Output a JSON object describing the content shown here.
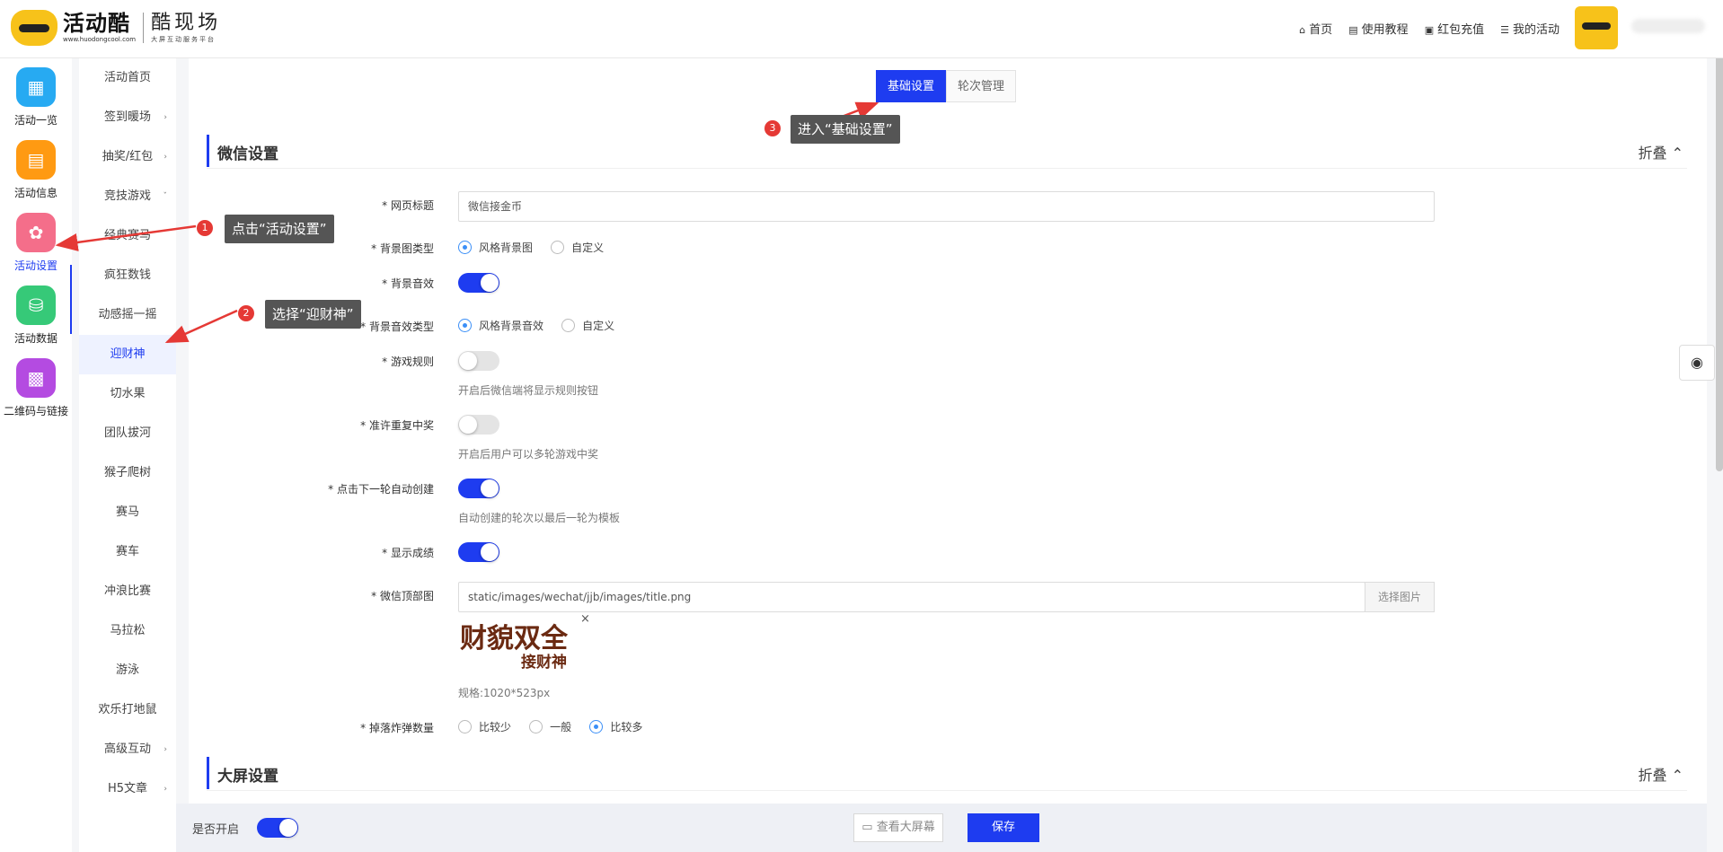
{
  "header": {
    "logo_main": "活动酷",
    "logo_url": "www.huodongcool.com",
    "logo_title": "酷现场",
    "logo_subtitle": "大屏互动服务平台",
    "nav": [
      {
        "icon": "home-icon",
        "label": "首页"
      },
      {
        "icon": "book-icon",
        "label": "使用教程"
      },
      {
        "icon": "wallet-icon",
        "label": "红包充值"
      },
      {
        "icon": "list-icon",
        "label": "我的活动"
      }
    ]
  },
  "rail": [
    {
      "label": "活动一览",
      "icon": "grid-icon",
      "color": "#27aaf2"
    },
    {
      "label": "活动信息",
      "icon": "document-icon",
      "color": "#ff9a12"
    },
    {
      "label": "活动设置",
      "icon": "gear-icon",
      "color": "#f46e8a",
      "active": true
    },
    {
      "label": "活动数据",
      "icon": "database-icon",
      "color": "#36c978"
    },
    {
      "label": "二维码与链接",
      "icon": "qrcode-icon",
      "color": "#b44be1"
    }
  ],
  "submenu": [
    {
      "label": "活动首页"
    },
    {
      "label": "签到暖场",
      "arrow": "›"
    },
    {
      "label": "抽奖/红包",
      "arrow": "›"
    },
    {
      "label": "竞技游戏",
      "arrow": "ˇ"
    },
    {
      "label": "经典赛马"
    },
    {
      "label": "疯狂数钱"
    },
    {
      "label": "动感摇一摇"
    },
    {
      "label": "迎财神",
      "active": true
    },
    {
      "label": "切水果"
    },
    {
      "label": "团队拔河"
    },
    {
      "label": "猴子爬树"
    },
    {
      "label": "赛马"
    },
    {
      "label": "赛车"
    },
    {
      "label": "冲浪比赛"
    },
    {
      "label": "马拉松"
    },
    {
      "label": "游泳"
    },
    {
      "label": "欢乐打地鼠"
    },
    {
      "label": "高级互动",
      "arrow": "›"
    },
    {
      "label": "H5文章",
      "arrow": "›"
    }
  ],
  "tabs": [
    "基础设置",
    "轮次管理"
  ],
  "wechat_section": {
    "title": "微信设置",
    "fold": "折叠 ⌃"
  },
  "screen_section": {
    "title": "大屏设置",
    "fold": "折叠 ⌃"
  },
  "form": {
    "page_title_label": "* 网页标题",
    "page_title_value": "微信接金币",
    "bg_type_label": "* 背景图类型",
    "bg_type_opt1": "风格背景图",
    "bg_type_opt2": "自定义",
    "bg_sound_label": "* 背景音效",
    "bg_sound_type_label": "* 背景音效类型",
    "bg_sound_opt1": "风格背景音效",
    "bg_sound_opt2": "自定义",
    "rules_label": "* 游戏规则",
    "rules_hint": "开启后微信端将显示规则按钮",
    "repeat_label": "* 准许重复中奖",
    "repeat_hint": "开启后用户可以多轮游戏中奖",
    "auto_label": "* 点击下一轮自动创建",
    "auto_hint": "自动创建的轮次以最后一轮为模板",
    "score_label": "* 显示成绩",
    "top_img_label": "* 微信顶部图",
    "top_img_value": "static/images/wechat/jjb/images/title.png",
    "pick_image": "选择图片",
    "image_text_1": "财貌双全",
    "image_text_2": "接财神",
    "close": "×",
    "spec": "规格:1020*523px",
    "bomb_label": "* 掉落炸弹数量",
    "bomb_opt1": "比较少",
    "bomb_opt2": "一般",
    "bomb_opt3": "比较多"
  },
  "footer": {
    "open_label": "是否开启",
    "view_screen": "查看大屏幕",
    "save": "保存"
  },
  "callouts": {
    "c1": "点击“活动设置”",
    "c2": "选择“迎财神”",
    "c3": "进入“基础设置”",
    "n1": "1",
    "n2": "2",
    "n3": "3"
  },
  "colors": {
    "accent": "#1e3cf0",
    "callout_badge": "#e53935",
    "callout_bg": "#555555"
  }
}
